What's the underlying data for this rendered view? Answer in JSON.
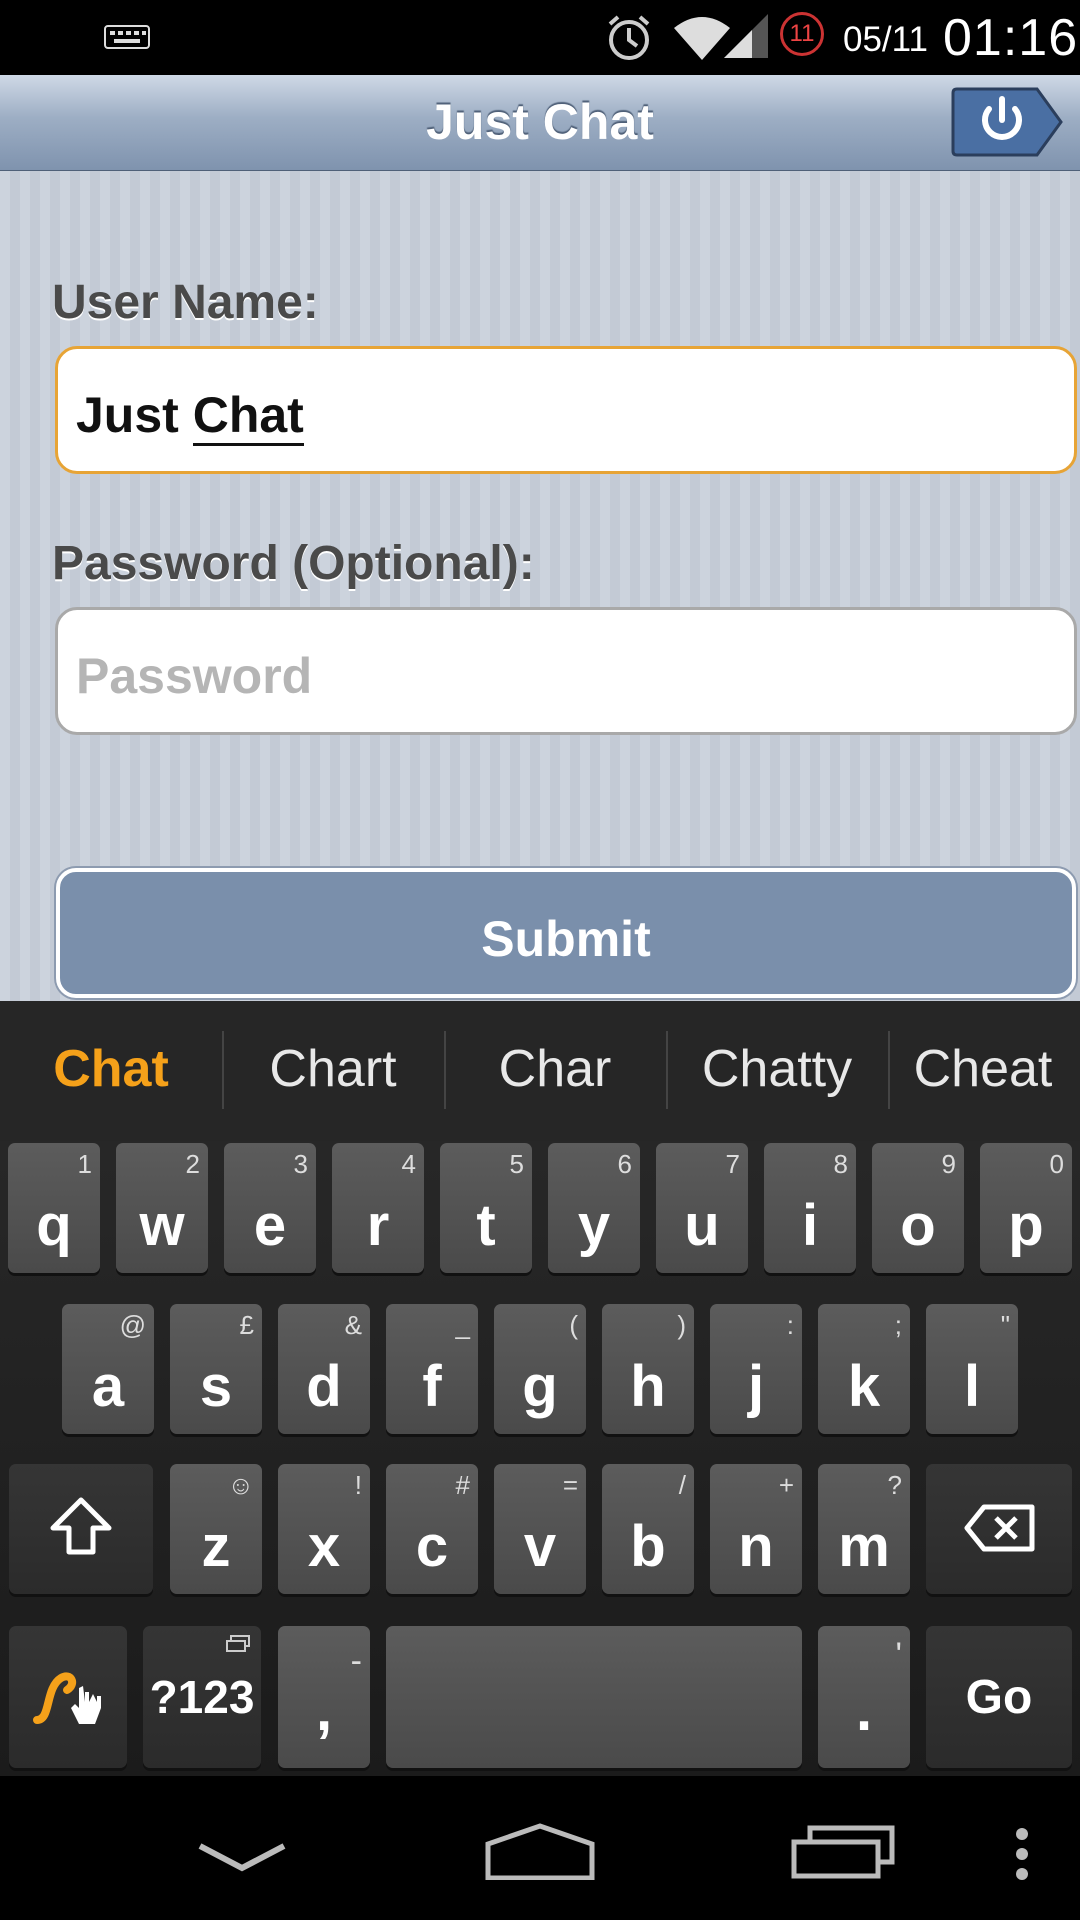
{
  "status_bar": {
    "date": "05/11",
    "time": "01:16",
    "notification_count": "11"
  },
  "header": {
    "title": "Just Chat"
  },
  "form": {
    "username_label": "User Name:",
    "username_value_part1": "Just",
    "username_value_part2": "Chat",
    "password_label": "Password (Optional):",
    "password_placeholder": "Password",
    "submit_label": "Submit"
  },
  "keyboard": {
    "suggestions": [
      "Chat",
      "Chart",
      "Char",
      "Chatty",
      "Cheat"
    ],
    "row1": [
      [
        "q",
        "1"
      ],
      [
        "w",
        "2"
      ],
      [
        "e",
        "3"
      ],
      [
        "r",
        "4"
      ],
      [
        "t",
        "5"
      ],
      [
        "y",
        "6"
      ],
      [
        "u",
        "7"
      ],
      [
        "i",
        "8"
      ],
      [
        "o",
        "9"
      ],
      [
        "p",
        "0"
      ]
    ],
    "row2": [
      [
        "a",
        "@"
      ],
      [
        "s",
        "£"
      ],
      [
        "d",
        "&"
      ],
      [
        "f",
        "_"
      ],
      [
        "g",
        "("
      ],
      [
        "h",
        ")"
      ],
      [
        "j",
        ":"
      ],
      [
        "k",
        ";"
      ],
      [
        "l",
        "\""
      ]
    ],
    "row3": [
      [
        "z",
        "☺"
      ],
      [
        "x",
        "!"
      ],
      [
        "c",
        "#"
      ],
      [
        "v",
        "="
      ],
      [
        "b",
        "/"
      ],
      [
        "n",
        "+"
      ],
      [
        "m",
        "?"
      ]
    ],
    "symbols_label": "?123",
    "comma": ",",
    "comma_hint": "-",
    "period": ".",
    "period_hint": "'",
    "go_label": "Go"
  }
}
